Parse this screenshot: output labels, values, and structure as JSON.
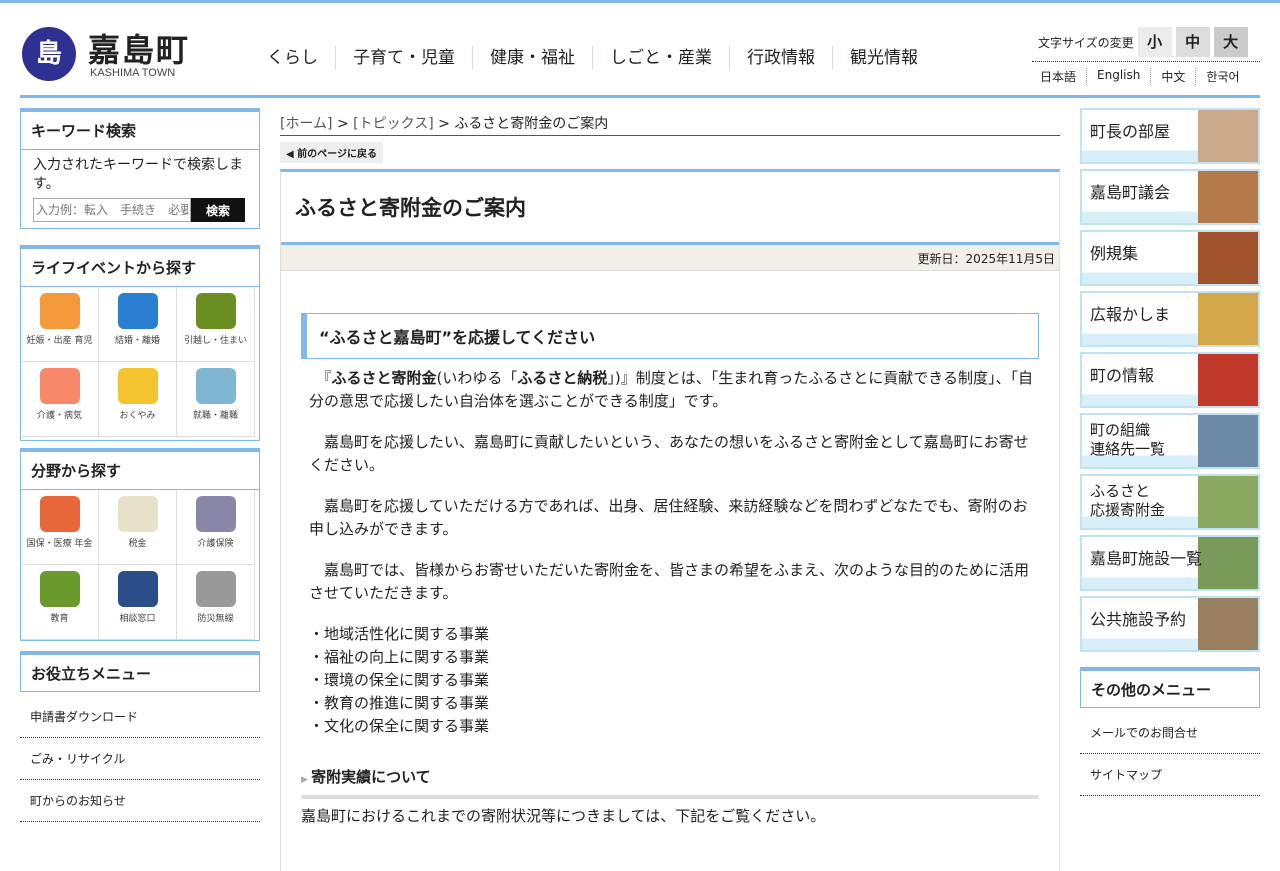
{
  "header": {
    "logo_jp": "嘉島町",
    "logo_en": "KASHIMA TOWN",
    "logo_mark": "島",
    "nav": [
      "くらし",
      "子育て・児童",
      "健康・福祉",
      "しごと・産業",
      "行政情報",
      "観光情報"
    ],
    "font_size_label": "文字サイズの変更",
    "font_sizes": [
      "小",
      "中",
      "大"
    ],
    "languages": [
      "日本語",
      "English",
      "中文",
      "한국어"
    ]
  },
  "left": {
    "keyword": {
      "title": "キーワード検索",
      "desc": "入力されたキーワードで検索します。",
      "placeholder": "入力例：転入　手続き　必要",
      "button": "検索"
    },
    "life": {
      "title": "ライフイベントから探す",
      "items": [
        {
          "label": "妊娠・出産 育児",
          "color": "#f39a3b"
        },
        {
          "label": "結婚・離婚",
          "color": "#2a7fd0"
        },
        {
          "label": "引越し・住まい",
          "color": "#6b8e23"
        },
        {
          "label": "介護・病気",
          "color": "#f5896a"
        },
        {
          "label": "おくやみ",
          "color": "#f4c430"
        },
        {
          "label": "就職・離職",
          "color": "#7fb6d0"
        }
      ]
    },
    "field": {
      "title": "分野から探す",
      "items": [
        {
          "label": "国保・医療 年金",
          "color": "#e8673a"
        },
        {
          "label": "税金",
          "color": "#e6e1c8"
        },
        {
          "label": "介護保険",
          "color": "#8a86a8"
        },
        {
          "label": "教育",
          "color": "#6a9a2a"
        },
        {
          "label": "相談窓口",
          "color": "#2a4e8a"
        },
        {
          "label": "防災無線",
          "color": "#999999"
        }
      ]
    },
    "useful": {
      "title": "お役立ちメニュー",
      "items": [
        "申請書ダウンロード",
        "ごみ・リサイクル",
        "町からのお知らせ"
      ]
    }
  },
  "main": {
    "breadcrumb": {
      "home": "[ホーム]",
      "topics": "[トピックス]",
      "current": "ふるさと寄附金のご案内",
      "sep": " > "
    },
    "back": "前のページに戻る",
    "title": "ふるさと寄附金のご案内",
    "updated": "更新日：2025年11月5日",
    "heading": "“ふるさと嘉島町”を応援してください",
    "p1a": "『",
    "p1b": "ふるさと寄附金",
    "p1c": "(いわゆる「",
    "p1d": "ふるさと納税",
    "p1e": "」)』制度とは、「生まれ育ったふるさとに貢献できる制度」、「自分の意思で応援したい自治体を選ぶことができる制度」です。",
    "p2": "嘉島町を応援したい、嘉島町に貢献したいという、あなたの想いをふるさと寄附金として嘉島町にお寄せください。",
    "p3": "嘉島町を応援していただける方であれば、出身、居住経験、来訪経験などを問わずどなたでも、寄附のお申し込みができます。",
    "p4": "嘉島町では、皆様からお寄せいただいた寄附金を、皆さまの希望をふまえ、次のような目的のために活用させていただきます。",
    "list": [
      "・地域活性化に関する事業",
      "・福祉の向上に関する事業",
      "・環境の保全に関する事業",
      "・教育の推進に関する事業",
      "・文化の保全に関する事業"
    ],
    "sub": "寄附実績について",
    "p5": "嘉島町におけるこれまでの寄附状況等につきましては、下記をご覧ください。"
  },
  "right": {
    "banners": [
      "町長の部屋",
      "嘉島町議会",
      "例規集",
      "広報かしま",
      "町の情報",
      "町の組織 連絡先一覧",
      "ふるさと 応援寄附金",
      "嘉島町施設一覧",
      "公共施設予約"
    ],
    "other": {
      "title": "その他のメニュー",
      "items": [
        "メールでのお問合せ",
        "サイトマップ"
      ]
    }
  }
}
